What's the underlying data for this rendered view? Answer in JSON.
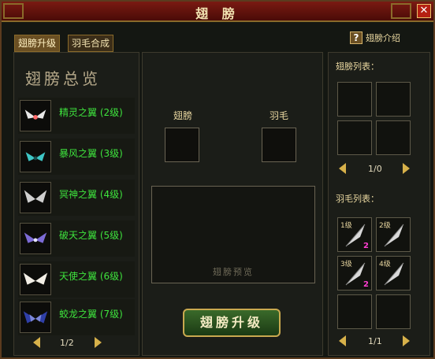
{
  "window": {
    "title": "翅 膀",
    "close_label": "✕"
  },
  "tabs": [
    {
      "label": "翅膀升级",
      "active": true
    },
    {
      "label": "羽毛合成",
      "active": false
    }
  ],
  "help": {
    "icon": "?",
    "label": "翅膀介绍"
  },
  "left": {
    "heading": "翅膀总览",
    "items": [
      {
        "label": "精灵之翼 (2级)",
        "icon": "wing-white-icon"
      },
      {
        "label": "暴风之翼 (3级)",
        "icon": "wing-teal-icon"
      },
      {
        "label": "冥神之翼 (4级)",
        "icon": "wing-silver-icon"
      },
      {
        "label": "破天之翼 (5级)",
        "icon": "wing-purple-icon"
      },
      {
        "label": "天使之翼 (6级)",
        "icon": "wing-angel-icon"
      },
      {
        "label": "蛟龙之翼 (7级)",
        "icon": "wing-dragon-icon"
      }
    ],
    "pager": "1/2"
  },
  "middle": {
    "wing_label": "翅膀",
    "feather_label": "羽毛",
    "preview_label": "翅膀预览",
    "upgrade_button": "翅膀升级"
  },
  "right": {
    "wing_list": {
      "heading": "翅膀列表：",
      "pager": "1/0"
    },
    "feather_list": {
      "heading": "羽毛列表：",
      "pager": "1/1",
      "items": [
        {
          "level": "1级",
          "count": "2"
        },
        {
          "level": "2级",
          "count": ""
        },
        {
          "level": "3级",
          "count": "2"
        },
        {
          "level": "4级",
          "count": ""
        }
      ]
    }
  },
  "colors": {
    "accent_gold": "#d7b14a",
    "wing_label_green": "#3ee33d",
    "count_magenta": "#ff3fd2"
  }
}
